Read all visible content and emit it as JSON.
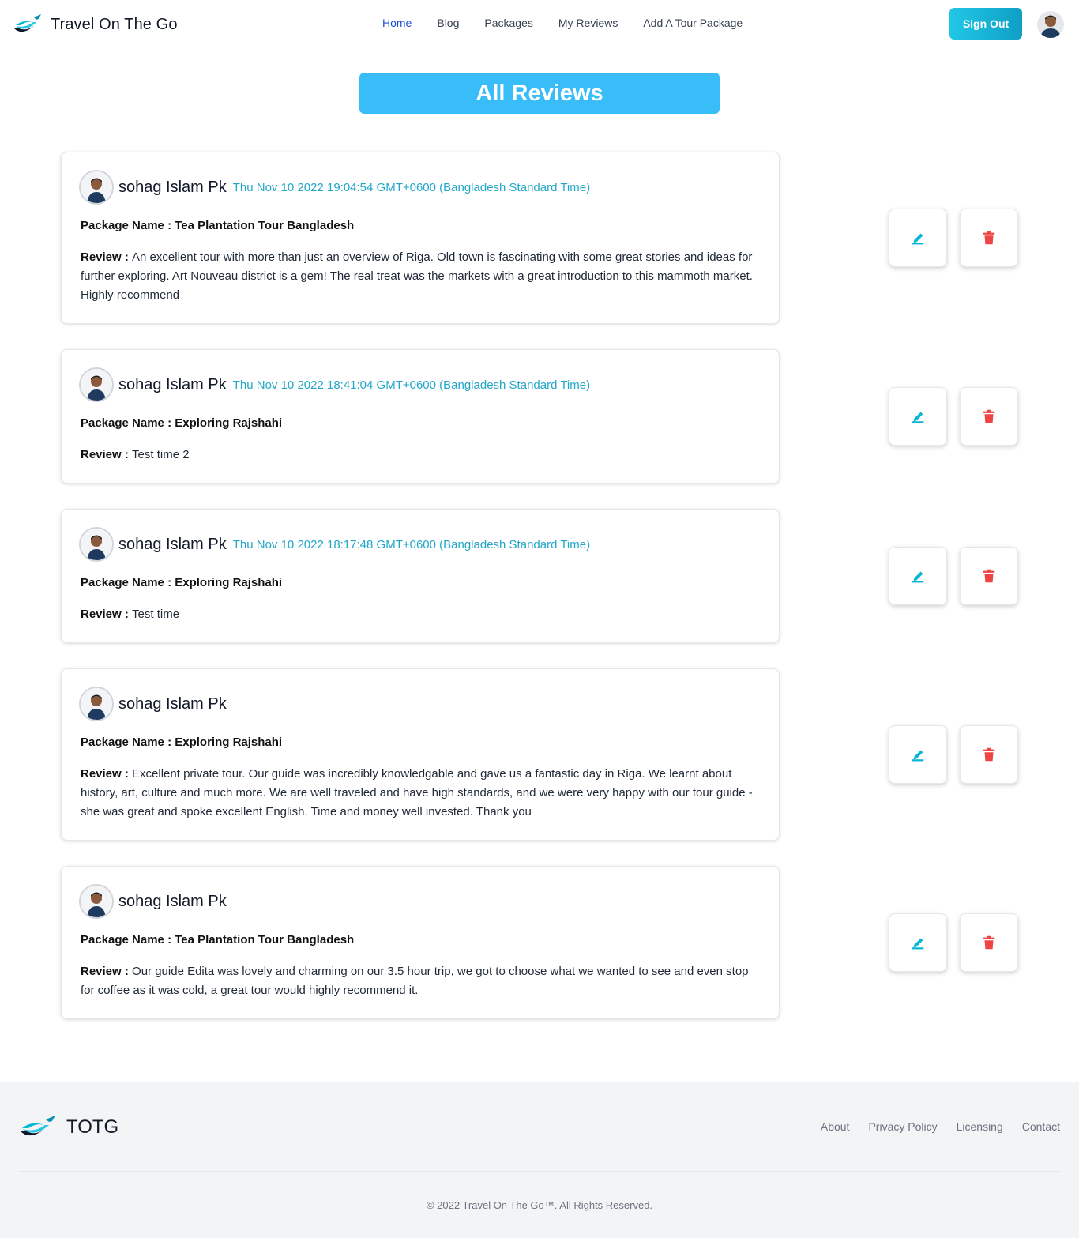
{
  "header": {
    "brand_name": "Travel On The Go",
    "nav": [
      "Home",
      "Blog",
      "Packages",
      "My Reviews",
      "Add A Tour Package"
    ],
    "active_nav": "Home",
    "signout_label": "Sign Out"
  },
  "page_title": "All Reviews",
  "labels": {
    "package_prefix": "Package Name : ",
    "review_prefix": "Review : "
  },
  "reviews": [
    {
      "name": "sohag Islam Pk",
      "date": "Thu Nov 10 2022 19:04:54 GMT+0600 (Bangladesh Standard Time)",
      "package": "Tea Plantation Tour Bangladesh",
      "review": "An excellent tour with more than just an overview of Riga. Old town is fascinating with some great stories and ideas for further exploring. Art Nouveau district is a gem! The real treat was the markets with a great introduction to this mammoth market. Highly recommend"
    },
    {
      "name": "sohag Islam Pk",
      "date": "Thu Nov 10 2022 18:41:04 GMT+0600 (Bangladesh Standard Time)",
      "package": "Exploring Rajshahi",
      "review": "Test time 2"
    },
    {
      "name": "sohag Islam Pk",
      "date": "Thu Nov 10 2022 18:17:48 GMT+0600 (Bangladesh Standard Time)",
      "package": "Exploring Rajshahi",
      "review": "Test time"
    },
    {
      "name": "sohag Islam Pk",
      "date": "",
      "package": "Exploring Rajshahi",
      "review": "Excellent private tour. Our guide was incredibly knowledgable and gave us a fantastic day in Riga. We learnt about history, art, culture and much more. We are well traveled and have high standards, and we were very happy with our tour guide - she was great and spoke excellent English. Time and money well invested. Thank you"
    },
    {
      "name": "sohag Islam Pk",
      "date": "",
      "package": "Tea Plantation Tour Bangladesh",
      "review": "Our guide Edita was lovely and charming on our 3.5 hour trip, we got to choose what we wanted to see and even stop for coffee as it was cold, a great tour would highly recommend it."
    }
  ],
  "icons": {
    "edit": "pencil-icon",
    "delete": "trash-icon"
  },
  "colors": {
    "accent": "#38bdf8",
    "date": "#22a7c7",
    "edit_icon": "#06b6d4",
    "delete_icon": "#ef4444",
    "active_nav": "#1d4ed8"
  },
  "footer": {
    "brand": "TOTG",
    "links": [
      "About",
      "Privacy Policy",
      "Licensing",
      "Contact"
    ],
    "copyright": "© 2022 Travel On The Go™. All Rights Reserved."
  }
}
